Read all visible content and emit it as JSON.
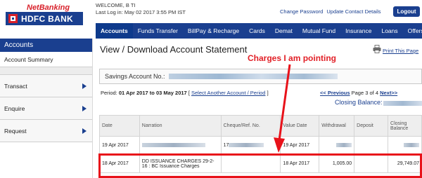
{
  "brand": {
    "netbanking": "NetBanking",
    "bank_name": "HDFC BANK"
  },
  "header": {
    "welcome": "WELCOME, B                         TI",
    "last_login": "Last Log in: May 02 2017 3:55 PM  IST",
    "links": [
      "Change Password",
      "Update Contact Details"
    ],
    "logout_label": "Logout"
  },
  "nav": {
    "tabs": [
      "Accounts",
      "Funds Transfer",
      "BillPay & Recharge",
      "Cards",
      "Demat",
      "Mutual Fund",
      "Insurance",
      "Loans",
      "Offers"
    ],
    "active_index": 0
  },
  "sidebar": {
    "heading": "Accounts",
    "sub_item": "Account Summary",
    "items": [
      "Transact",
      "Enquire",
      "Request"
    ]
  },
  "main": {
    "title": "View / Download Account Statement",
    "print_label": "Print This Page",
    "account_label": "Savings Account No.:",
    "period_label": "Period:",
    "period_value": "01 Apr 2017 to 03 May 2017",
    "period_link": "Select Another Account / Period",
    "pager_prev": "<< Previous",
    "pager_text": "Page 3 of 4",
    "pager_next": "Next>>",
    "closing_label": "Closing Balance:"
  },
  "annotation": {
    "text": "Charges I am pointing"
  },
  "table": {
    "headers": [
      "Date",
      "Narration",
      "Cheque/Ref. No.",
      "Value Date",
      "Withdrawal",
      "Deposit",
      "Closing Balance"
    ],
    "rows": [
      {
        "date": "19 Apr 2017",
        "narration": "",
        "ref": "17",
        "value_date": "19 Apr 2017",
        "withdrawal": "",
        "deposit": "",
        "closing": ""
      },
      {
        "date": "18 Apr 2017",
        "narration": "DD ISSUANCE CHARGES 29-2-16 : BC Issuance Charges",
        "ref": "",
        "value_date": "18 Apr 2017",
        "withdrawal": "1,005.00",
        "deposit": "",
        "closing": "29,749.07"
      }
    ]
  },
  "colors": {
    "brand_blue": "#1a3f8f",
    "brand_red": "#d8202a",
    "annotation_red": "#e21f26"
  }
}
